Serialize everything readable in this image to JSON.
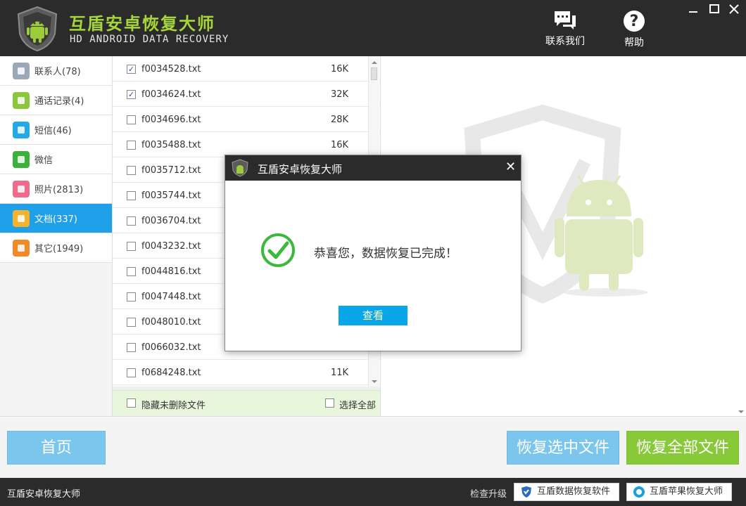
{
  "header": {
    "title": "互盾安卓恢复大师",
    "subtitle": "HD ANDROID DATA RECOVERY",
    "contact_label": "联系我们",
    "help_label": "帮助"
  },
  "sidebar": {
    "items": [
      {
        "label": "联系人(78)",
        "icon": "contacts-icon",
        "color": "#9aa8b8"
      },
      {
        "label": "通话记录(4)",
        "icon": "phone-icon",
        "color": "#8cc63f"
      },
      {
        "label": "短信(46)",
        "icon": "message-icon",
        "color": "#23a8e8"
      },
      {
        "label": "微信",
        "icon": "wechat-icon",
        "color": "#3bb03b"
      },
      {
        "label": "照片(2813)",
        "icon": "photo-icon",
        "color": "#f06b8a"
      },
      {
        "label": "文档(337)",
        "icon": "document-icon",
        "color": "#f5b22c",
        "active": true
      },
      {
        "label": "其它(1949)",
        "icon": "other-icon",
        "color": "#f08a2a"
      }
    ]
  },
  "files": [
    {
      "name": "f0034528.txt",
      "size": "16K",
      "checked": true
    },
    {
      "name": "f0034624.txt",
      "size": "32K",
      "checked": true
    },
    {
      "name": "f0034696.txt",
      "size": "28K",
      "checked": false
    },
    {
      "name": "f0035488.txt",
      "size": "16K",
      "checked": false
    },
    {
      "name": "f0035712.txt",
      "size": "",
      "checked": false
    },
    {
      "name": "f0035744.txt",
      "size": "",
      "checked": false
    },
    {
      "name": "f0036704.txt",
      "size": "",
      "checked": false
    },
    {
      "name": "f0043232.txt",
      "size": "",
      "checked": false
    },
    {
      "name": "f0044816.txt",
      "size": "",
      "checked": false
    },
    {
      "name": "f0047448.txt",
      "size": "",
      "checked": false
    },
    {
      "name": "f0048010.txt",
      "size": "",
      "checked": false
    },
    {
      "name": "f0066032.txt",
      "size": "",
      "checked": false
    },
    {
      "name": "f0684248.txt",
      "size": "11K",
      "checked": false
    }
  ],
  "filter": {
    "hide_undeleted_label": "隐藏未删除文件",
    "select_all_label": "选择全部"
  },
  "actions": {
    "home_label": "首页",
    "recover_selected_label": "恢复选中文件",
    "recover_all_label": "恢复全部文件"
  },
  "status": {
    "app_name": "互盾安卓恢复大师",
    "upgrade_label": "检查升级",
    "promo1_label": "互盾数据恢复软件",
    "promo2_label": "互盾苹果恢复大师"
  },
  "dialog": {
    "title": "互盾安卓恢复大师",
    "message": "恭喜您，数据恢复已完成！",
    "button_label": "查看"
  },
  "colors": {
    "accent_blue": "#20a0e8",
    "accent_green": "#88c93a",
    "brand_green": "#a6d63a",
    "header_bg": "#2b2b2b"
  }
}
